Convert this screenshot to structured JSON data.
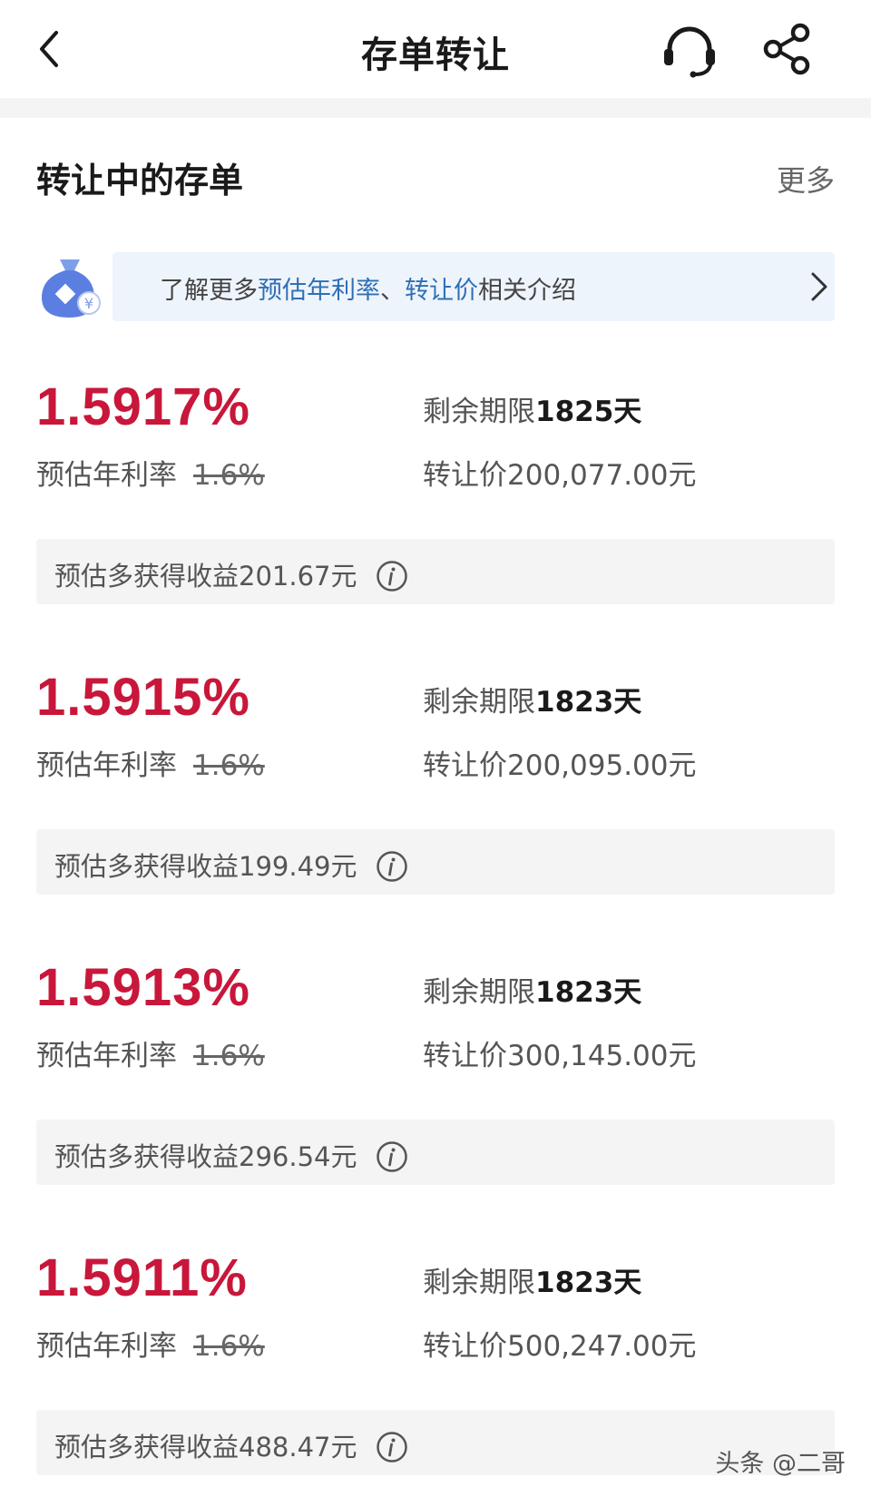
{
  "header": {
    "title": "存单转让"
  },
  "section": {
    "title": "转让中的存单",
    "more_label": "更多"
  },
  "banner": {
    "text_prefix": "了解更多",
    "highlight_1": "预估年利率",
    "separator": "、",
    "highlight_2": "转让价",
    "text_suffix": "相关介绍"
  },
  "cards": [
    {
      "rate": "1.5917%",
      "rate_label": "预估年利率",
      "original_rate": "1.6%",
      "term_label": "剩余期限",
      "term_value": "1825天",
      "price_label": "转让价",
      "price_value": "200,077.00元",
      "gain_label": "预估多获得收益",
      "gain_value": "201.67元"
    },
    {
      "rate": "1.5915%",
      "rate_label": "预估年利率",
      "original_rate": "1.6%",
      "term_label": "剩余期限",
      "term_value": "1823天",
      "price_label": "转让价",
      "price_value": "200,095.00元",
      "gain_label": "预估多获得收益",
      "gain_value": "199.49元"
    },
    {
      "rate": "1.5913%",
      "rate_label": "预估年利率",
      "original_rate": "1.6%",
      "term_label": "剩余期限",
      "term_value": "1823天",
      "price_label": "转让价",
      "price_value": "300,145.00元",
      "gain_label": "预估多获得收益",
      "gain_value": "296.54元"
    },
    {
      "rate": "1.5911%",
      "rate_label": "预估年利率",
      "original_rate": "1.6%",
      "term_label": "剩余期限",
      "term_value": "1823天",
      "price_label": "转让价",
      "price_value": "500,247.00元",
      "gain_label": "预估多获得收益",
      "gain_value": "488.47元"
    }
  ],
  "watermark": "头条 @二哥",
  "colors": {
    "rate_red": "#c8173a",
    "link_blue": "#2f6fb6",
    "banner_bg": "#eef4fb",
    "gain_bg": "#f4f4f4"
  }
}
